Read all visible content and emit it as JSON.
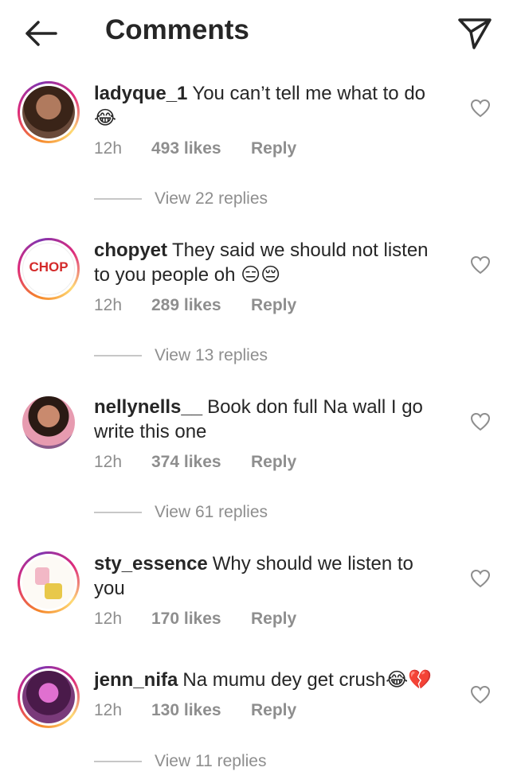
{
  "header": {
    "title": "Comments",
    "back_icon": "arrow-left-icon",
    "share_icon": "paper-plane-icon"
  },
  "colors": {
    "text": "#262626",
    "secondary": "#8e8e8e",
    "story_ring": [
      "#f58529",
      "#dd2a7b",
      "#8134af"
    ]
  },
  "comments": [
    {
      "username": "ladyque_1",
      "text": "You can’t tell me what to do",
      "emoji": "😂",
      "time": "12h",
      "likes": "493 likes",
      "reply": "Reply",
      "view_replies": "View 22 replies"
    },
    {
      "username": "chopyet",
      "text": "They said we should not listen to you people oh",
      "emoji": "😑😔",
      "time": "12h",
      "likes": "289 likes",
      "reply": "Reply",
      "view_replies": "View 13 replies",
      "avatar_text": "CHOP"
    },
    {
      "username": "nellynells__",
      "text": "Book don full Na wall I go write this one",
      "time": "12h",
      "likes": "374 likes",
      "reply": "Reply",
      "view_replies": "View 61 replies"
    },
    {
      "username": "sty_essence",
      "text": "Why should we listen to you",
      "time": "12h",
      "likes": "170 likes",
      "reply": "Reply"
    },
    {
      "username": "jenn_nifa",
      "text": "Na mumu dey get crush",
      "emoji": "😂💔",
      "time": "12h",
      "likes": "130 likes",
      "reply": "Reply",
      "view_replies": "View 11 replies"
    }
  ]
}
